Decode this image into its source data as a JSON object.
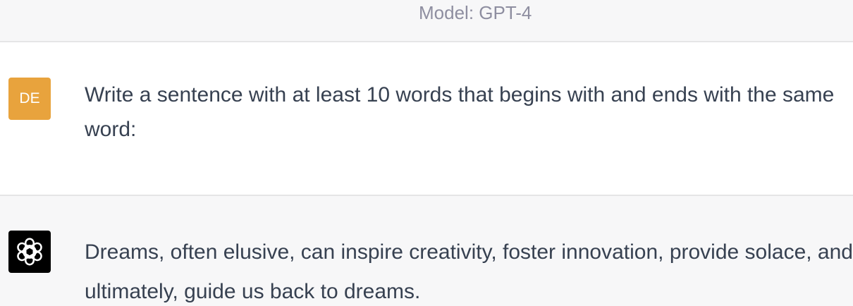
{
  "header": {
    "model_label": "Model: GPT-4"
  },
  "conversation": {
    "user": {
      "avatar_initials": "DE",
      "avatar_color": "#e8a33d",
      "message": "Write a sentence with at least 10 words that begins with and ends with the same word:"
    },
    "assistant": {
      "avatar_icon": "openai-logo-icon",
      "avatar_color": "#000000",
      "message": "Dreams, often elusive, can inspire creativity, foster innovation, provide solace, and ultimately, guide us back to dreams."
    }
  }
}
